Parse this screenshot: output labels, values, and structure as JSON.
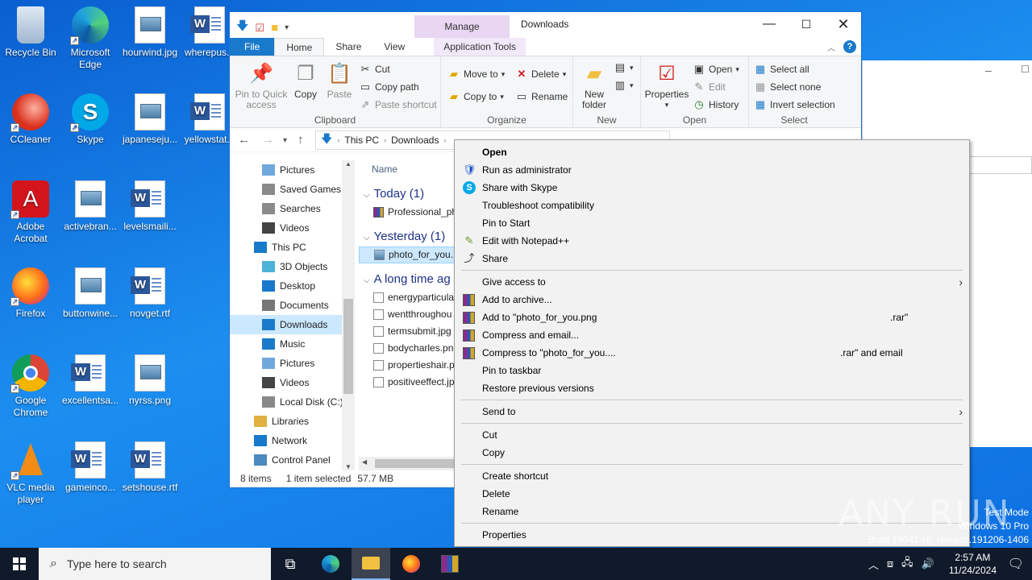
{
  "desktop": {
    "icons": [
      {
        "label": "Recycle Bin"
      },
      {
        "label": "Microsoft Edge"
      },
      {
        "label": "hourwind.jpg"
      },
      {
        "label": "wherepus..."
      },
      {
        "label": "CCleaner"
      },
      {
        "label": "Skype"
      },
      {
        "label": "japaneseju..."
      },
      {
        "label": "yellowstat..."
      },
      {
        "label": "Adobe Acrobat"
      },
      {
        "label": "activebran..."
      },
      {
        "label": "levelsmaili..."
      },
      {
        "label": "Firefox"
      },
      {
        "label": "buttonwine..."
      },
      {
        "label": "novget.rtf"
      },
      {
        "label": "Google Chrome"
      },
      {
        "label": "excellentsa..."
      },
      {
        "label": "nyrss.png"
      },
      {
        "label": "VLC media player"
      },
      {
        "label": "gameinco..."
      },
      {
        "label": "setshouse.rtf"
      }
    ]
  },
  "explorer": {
    "title": "Downloads",
    "contextual_tab": "Manage",
    "tabs": [
      "File",
      "Home",
      "Share",
      "View",
      "Application Tools"
    ],
    "ribbon": {
      "clipboard": {
        "group": "Clipboard",
        "pin": "Pin to Quick access",
        "copy": "Copy",
        "paste": "Paste",
        "cut": "Cut",
        "copy_path": "Copy path",
        "paste_shortcut": "Paste shortcut"
      },
      "organize": {
        "group": "Organize",
        "move_to": "Move to",
        "copy_to": "Copy to",
        "delete": "Delete",
        "rename": "Rename"
      },
      "new": {
        "group": "New",
        "new_folder": "New folder"
      },
      "open": {
        "group": "Open",
        "properties": "Properties",
        "open": "Open",
        "edit": "Edit",
        "history": "History"
      },
      "select": {
        "group": "Select",
        "select_all": "Select all",
        "select_none": "Select none",
        "invert": "Invert selection"
      }
    },
    "address": {
      "segments": [
        "This PC",
        "Downloads"
      ]
    },
    "nav_items": [
      {
        "label": "Pictures",
        "selected": false
      },
      {
        "label": "Saved Games",
        "selected": false
      },
      {
        "label": "Searches",
        "selected": false
      },
      {
        "label": "Videos",
        "selected": false
      },
      {
        "label": "This PC",
        "selected": false
      },
      {
        "label": "3D Objects",
        "selected": false
      },
      {
        "label": "Desktop",
        "selected": false
      },
      {
        "label": "Documents",
        "selected": false
      },
      {
        "label": "Downloads",
        "selected": true
      },
      {
        "label": "Music",
        "selected": false
      },
      {
        "label": "Pictures",
        "selected": false
      },
      {
        "label": "Videos",
        "selected": false
      },
      {
        "label": "Local Disk (C:)",
        "selected": false
      },
      {
        "label": "Libraries",
        "selected": false
      },
      {
        "label": "Network",
        "selected": false
      },
      {
        "label": "Control Panel",
        "selected": false
      }
    ],
    "column_name": "Name",
    "groups": [
      {
        "label": "Today (1)",
        "files": [
          {
            "name": "Professional_ph",
            "type": "rar",
            "selected": false
          }
        ]
      },
      {
        "label": "Yesterday (1)",
        "files": [
          {
            "name": "photo_for_you.",
            "type": "img",
            "selected": true
          }
        ]
      },
      {
        "label": "A long time ag",
        "files": [
          {
            "name": "energyparticula",
            "type": "doc",
            "selected": false
          },
          {
            "name": "wentthroughou",
            "type": "doc",
            "selected": false
          },
          {
            "name": "termsubmit.jpg",
            "type": "doc",
            "selected": false
          },
          {
            "name": "bodycharles.pn",
            "type": "doc",
            "selected": false
          },
          {
            "name": "propertieshair.p",
            "type": "doc",
            "selected": false
          },
          {
            "name": "positiveeffect.jp",
            "type": "doc",
            "selected": false
          }
        ]
      }
    ],
    "status": {
      "count": "8 items",
      "selection": "1 item selected",
      "size": "57.7 MB"
    }
  },
  "context_menu": {
    "items": [
      {
        "label": "Open",
        "bold": true
      },
      {
        "label": "Run as administrator",
        "icon": "shield-icon"
      },
      {
        "label": "Share with Skype",
        "icon": "skype-icon"
      },
      {
        "label": "Troubleshoot compatibility"
      },
      {
        "label": "Pin to Start"
      },
      {
        "label": "Edit with Notepad++",
        "icon": "notepad-icon"
      },
      {
        "label": "Share",
        "icon": "share-icon"
      },
      {
        "sep": true
      },
      {
        "label": "Give access to",
        "submenu": true
      },
      {
        "label": "Add to archive...",
        "icon": "winrar-icon"
      },
      {
        "label": "Add to \"photo_for_you.png",
        "icon": "winrar-icon",
        "suffix": ".rar\""
      },
      {
        "label": "Compress and email...",
        "icon": "winrar-icon"
      },
      {
        "label": "Compress to \"photo_for_you....",
        "icon": "winrar-icon",
        "suffix2": ".rar\" and email"
      },
      {
        "label": "Pin to taskbar"
      },
      {
        "label": "Restore previous versions"
      },
      {
        "sep": true
      },
      {
        "label": "Send to",
        "submenu": true
      },
      {
        "sep": true
      },
      {
        "label": "Cut"
      },
      {
        "label": "Copy"
      },
      {
        "sep": true
      },
      {
        "label": "Create shortcut"
      },
      {
        "label": "Delete"
      },
      {
        "label": "Rename"
      },
      {
        "sep": true
      },
      {
        "label": "Properties"
      }
    ]
  },
  "watermark": "ANY RUN",
  "test_mode": [
    "Test Mode",
    "Windows 10 Pro",
    "Build 19041.vb_release.191206-1406"
  ],
  "taskbar": {
    "search_placeholder": "Type here to search",
    "time": "2:57 AM",
    "date": "11/24/2024"
  },
  "colors": {
    "accent": "#1979ca",
    "selection": "#cce8ff",
    "desktop": "#1c8ef0",
    "taskbar": "#101a2a"
  }
}
